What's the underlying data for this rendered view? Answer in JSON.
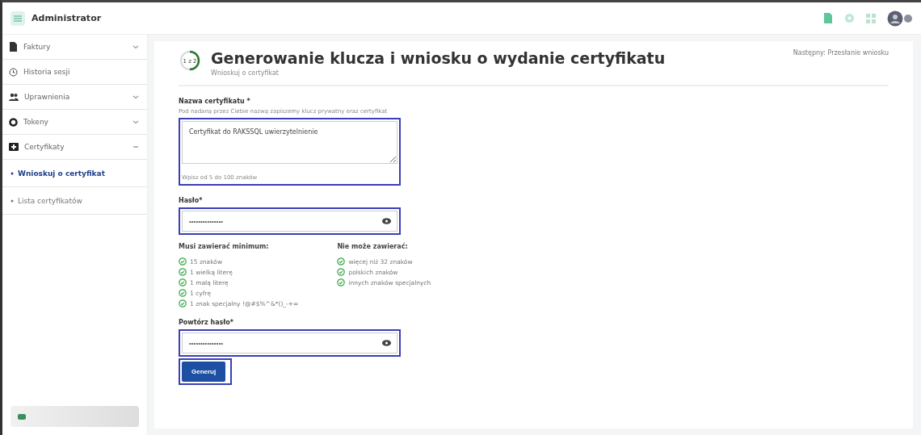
{
  "app": {
    "title": "Administrator"
  },
  "sidebar": {
    "items": [
      {
        "label": "Faktury",
        "expanded": false
      },
      {
        "label": "Historia sesji"
      },
      {
        "label": "Uprawnienia",
        "expanded": false
      },
      {
        "label": "Tokeny",
        "expanded": false
      },
      {
        "label": "Certyfikaty",
        "expanded": true,
        "children": [
          {
            "label": "Wnioskuj o certyfikat",
            "selected": true
          },
          {
            "label": "Lista certyfikatów",
            "selected": false
          }
        ]
      }
    ]
  },
  "header": {
    "step": "1 z 2",
    "title": "Generowanie klucza i wniosku o wydanie certyfikatu",
    "subtitle": "Wnioskuj o certyfikat",
    "next": "Następny: Przesłanie wniosku"
  },
  "name_field": {
    "label": "Nazwa certyfikatu *",
    "hint": "Pod nadaną przez Ciebie nazwą zapiszemy klucz prywatny oraz certyfikat",
    "value": "Certyfikat do RAKSSQL uwierzytelnienie",
    "counter": "Wpisz od 5 do 100 znaków"
  },
  "password_field": {
    "label": "Hasło*",
    "value": "•••••••••••••••"
  },
  "rules": [
    {
      "title": "Musi zawierać minimum:",
      "items": [
        {
          "text": "15 znaków",
          "met": true
        },
        {
          "text": "1 wielką literę",
          "met": true
        },
        {
          "text": "1 małą literę",
          "met": true
        },
        {
          "text": "1 cyfrę",
          "met": true
        },
        {
          "text": "1 znak specjalny !@#$%^&*()_-+=",
          "met": true
        }
      ]
    },
    {
      "title": "Nie może zawierać:",
      "items": [
        {
          "text": "więcej niż 32 znaków",
          "met": true
        },
        {
          "text": "polskich znaków",
          "met": true
        },
        {
          "text": "innych znaków specjalnych",
          "met": true
        }
      ]
    }
  ],
  "repeat_field": {
    "label": "Powtórz hasło*",
    "value": "•••••••••••••••"
  },
  "submit": {
    "label": "Generuj"
  }
}
